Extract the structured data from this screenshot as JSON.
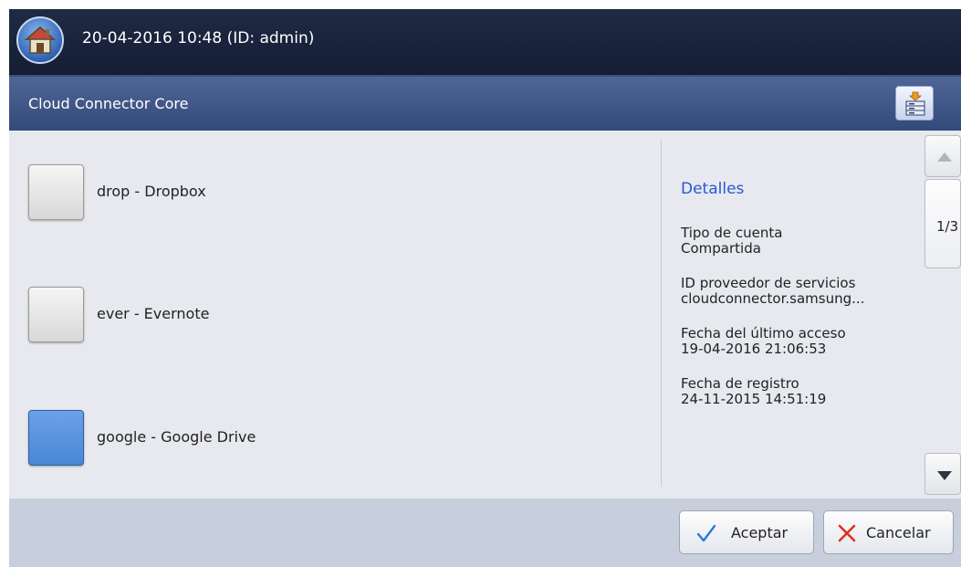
{
  "header": {
    "datetime_user": "20-04-2016 10:48 (ID: admin)"
  },
  "titlebar": {
    "title": "Cloud Connector Core"
  },
  "list": {
    "items": [
      {
        "label": "drop - Dropbox",
        "selected": false
      },
      {
        "label": "ever - Evernote",
        "selected": false
      },
      {
        "label": "google - Google Drive",
        "selected": true
      }
    ]
  },
  "details": {
    "title": "Detalles",
    "fields": [
      {
        "label": "Tipo de cuenta",
        "value": "Compartida"
      },
      {
        "label": "ID proveedor de servicios",
        "value": "cloudconnector.samsung..."
      },
      {
        "label": "Fecha del último acceso",
        "value": "19-04-2016 21:06:53"
      },
      {
        "label": "Fecha de registro",
        "value": "24-11-2015 14:51:19"
      }
    ]
  },
  "pagination": {
    "page": "1/3"
  },
  "buttons": {
    "ok": "Aceptar",
    "cancel": "Cancelar"
  },
  "colors": {
    "accent": "#2a56d6",
    "selected": "#5b95e0",
    "cancel_icon": "#e0301e",
    "ok_icon": "#2a7ad8"
  },
  "icons": [
    "home-icon",
    "server-export-icon",
    "check-icon",
    "x-icon",
    "scroll-up-icon",
    "scroll-down-icon"
  ]
}
